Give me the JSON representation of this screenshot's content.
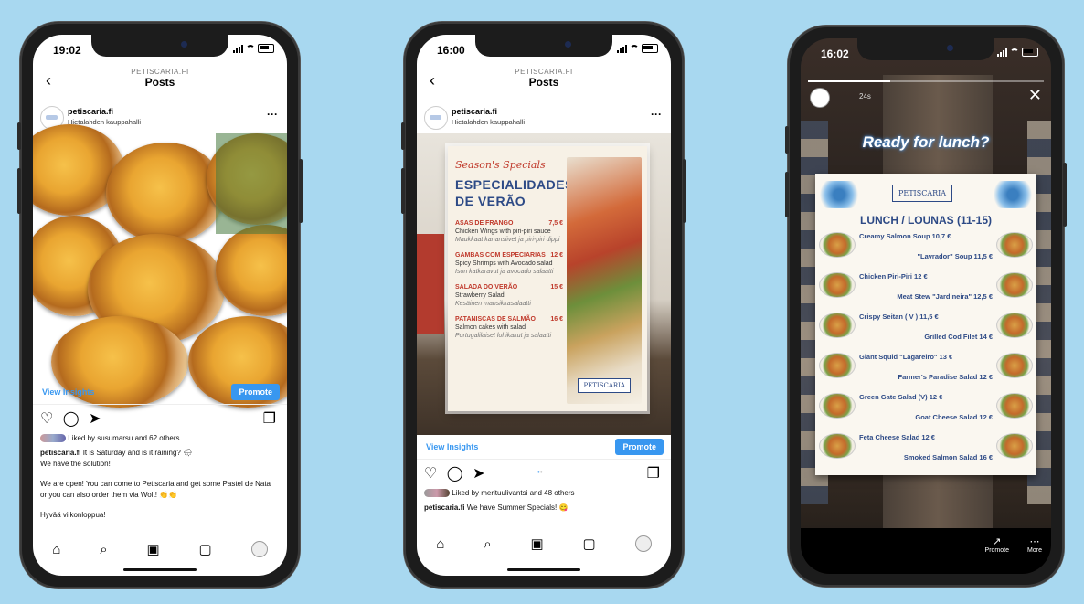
{
  "phones": [
    {
      "time": "19:02",
      "header_account": "PETISCARIA.FI",
      "header_title": "Posts",
      "username": "petiscaria.fi",
      "location": "Hietalahden kauppahalli",
      "insights_label": "View Insights",
      "promote_label": "Promote",
      "liked_by": "Liked by susumarsu and 62 others",
      "caption_user": "petiscaria.fi",
      "caption_lines": [
        "It is Saturday and is it raining? 🌧",
        "We have the solution!",
        "",
        "We are open! You can come to Petiscaria and get some Pastel de Nata or you can also order them via Wolt! 👏👏",
        "",
        "Hyvää viikonloppua!"
      ]
    },
    {
      "time": "16:00",
      "header_account": "PETISCARIA.FI",
      "header_title": "Posts",
      "username": "petiscaria.fi",
      "location": "Hietalahden kauppahalli",
      "insights_label": "View Insights",
      "promote_label": "Promote",
      "liked_by": "Liked by merituulivantsi and 48 others",
      "caption_user": "petiscaria.fi",
      "caption_text": "We have Summer Specials! 😋",
      "menu": {
        "script_title": "Season's Specials",
        "title_line1": "ESPECIALIDADES",
        "title_line2": "DE VERÃO",
        "items": [
          {
            "name": "ASAS DE FRANGO",
            "price": "7,5 €",
            "desc": "Chicken Wings with piri-piri sauce",
            "desc_fi": "Maukkaat kanansiivet ja piri-piri dippi"
          },
          {
            "name": "GAMBAS COM ESPECIARIAS",
            "price": "12 €",
            "desc": "Spicy Shrimps with Avocado salad",
            "desc_fi": "Ison katkaravut ja avocado salaatti"
          },
          {
            "name": "SALADA DO VERÃO",
            "price": "15 €",
            "desc": "Strawberry Salad",
            "desc_fi": "Kesäinen mansikkasalaatti"
          },
          {
            "name": "PATANISCAS DE SALMÃO",
            "price": "16 €",
            "desc": "Salmon cakes with salad",
            "desc_fi": "Portugalilaiset lohikakut ja salaatti"
          }
        ],
        "logo_text": "PETISCARIA"
      }
    },
    {
      "time": "16:02",
      "story_elapsed": "24s",
      "story_text": "Ready for lunch?",
      "board_logo": "PETISCARIA",
      "board_title": "LUNCH / LOUNAS (11-15)",
      "board_items": [
        "Creamy Salmon Soup 10,7 €",
        "\"Lavrador\" Soup 11,5 €",
        "Chicken Piri-Piri 12 €",
        "Meat Stew \"Jardineira\" 12,5 €",
        "Crispy Seitan ( V ) 11,5 €",
        "Grilled Cod Filet 14 €",
        "Giant Squid \"Lagareiro\" 13 €",
        "Farmer's Paradise Salad 12 €",
        "Green Gate Salad (V) 12 €",
        "Goat Cheese Salad 12 €",
        "Feta Cheese Salad 12 €",
        "Smoked Salmon Salad 16 €"
      ],
      "promote_label": "Promote",
      "more_label": "More"
    }
  ],
  "colors": {
    "background": "#a8d8f0",
    "instagram_blue": "#3897f0",
    "menu_red": "#c0392b"
  }
}
